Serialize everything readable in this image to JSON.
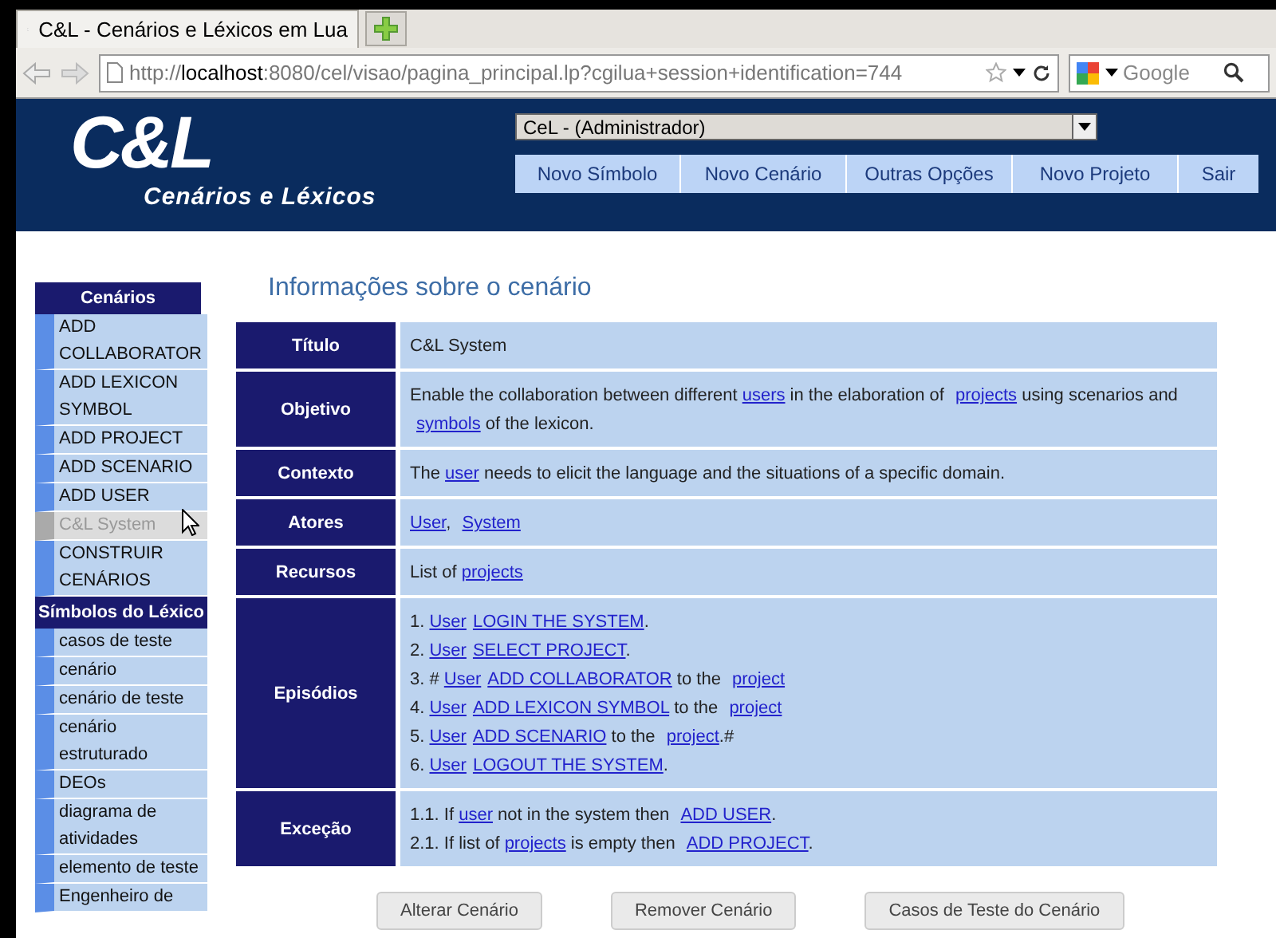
{
  "browser": {
    "tab_title": "C&L - Cenários e Léxicos em Lua",
    "url_prefix": "http://",
    "url_host": "localhost",
    "url_rest": ":8080/cel/visao/pagina_principal.lp?cgilua+session+identification=744",
    "search_placeholder": "Google"
  },
  "header": {
    "logo": "C&L",
    "subtitle": "Cenários e Léxicos",
    "project_select": "CeL - (Administrador)",
    "nav": [
      "Novo Símbolo",
      "Novo Cenário",
      "Outras Opções",
      "Novo Projeto",
      "Sair"
    ]
  },
  "sidebar": {
    "sections": [
      {
        "title": "Cenários",
        "items": [
          {
            "label": "ADD COLLABORATOR",
            "selected": false
          },
          {
            "label": "ADD LEXICON SYMBOL",
            "selected": false
          },
          {
            "label": "ADD PROJECT",
            "selected": false
          },
          {
            "label": "ADD SCENARIO",
            "selected": false
          },
          {
            "label": "ADD USER",
            "selected": false
          },
          {
            "label": "C&L System",
            "selected": true
          },
          {
            "label": "CONSTRUIR CENÁRIOS",
            "selected": false
          }
        ]
      },
      {
        "title": "Símbolos do Léxico",
        "items": [
          {
            "label": "casos de teste",
            "selected": false
          },
          {
            "label": "cenário",
            "selected": false
          },
          {
            "label": "cenário de teste",
            "selected": false
          },
          {
            "label": "cenário estruturado",
            "selected": false
          },
          {
            "label": "DEOs",
            "selected": false
          },
          {
            "label": "diagrama de atividades",
            "selected": false
          },
          {
            "label": "elemento de teste",
            "selected": false
          },
          {
            "label": "Engenheiro de",
            "selected": false
          }
        ]
      }
    ]
  },
  "main": {
    "title": "Informações sobre o cenário",
    "rows": [
      {
        "label": "Título",
        "lines": [
          [
            {
              "text": "C&L System"
            }
          ]
        ]
      },
      {
        "label": "Objetivo",
        "lines": [
          [
            {
              "text": "Enable the collaboration between different "
            },
            {
              "link": "users"
            },
            {
              "text": " in the elaboration of "
            },
            {
              "link": "projects"
            },
            {
              "text": " using scenarios and "
            },
            {
              "link": "symbols"
            },
            {
              "text": " of the lexicon."
            }
          ]
        ]
      },
      {
        "label": "Contexto",
        "lines": [
          [
            {
              "text": "The "
            },
            {
              "link": "user"
            },
            {
              "text": " needs to elicit the language and the situations of a specific domain."
            }
          ]
        ]
      },
      {
        "label": "Atores",
        "lines": [
          [
            {
              "link": "User"
            },
            {
              "text": ", "
            },
            {
              "link": "System"
            }
          ]
        ]
      },
      {
        "label": "Recursos",
        "lines": [
          [
            {
              "text": "List of "
            },
            {
              "link": "projects"
            }
          ]
        ]
      },
      {
        "label": "Episódios",
        "lines": [
          [
            {
              "text": "1. "
            },
            {
              "link": "User"
            },
            {
              "link": "LOGIN THE SYSTEM"
            },
            {
              "text": "."
            }
          ],
          [
            {
              "text": "2. "
            },
            {
              "link": "User"
            },
            {
              "link": "SELECT PROJECT"
            },
            {
              "text": "."
            }
          ],
          [
            {
              "text": "3. # "
            },
            {
              "link": "User"
            },
            {
              "link": "ADD COLLABORATOR"
            },
            {
              "text": " to the "
            },
            {
              "link": "project"
            }
          ],
          [
            {
              "text": "4. "
            },
            {
              "link": "User"
            },
            {
              "link": "ADD LEXICON SYMBOL"
            },
            {
              "text": " to the "
            },
            {
              "link": "project"
            }
          ],
          [
            {
              "text": "5. "
            },
            {
              "link": "User"
            },
            {
              "link": "ADD SCENARIO"
            },
            {
              "text": " to the "
            },
            {
              "link": "project"
            },
            {
              "text": ".#"
            }
          ],
          [
            {
              "text": "6. "
            },
            {
              "link": "User"
            },
            {
              "link": "LOGOUT THE SYSTEM"
            },
            {
              "text": "."
            }
          ]
        ]
      },
      {
        "label": "Exceção",
        "lines": [
          [
            {
              "text": "1.1. If "
            },
            {
              "link": "user"
            },
            {
              "text": " not in the system then "
            },
            {
              "link": "ADD USER"
            },
            {
              "text": "."
            }
          ],
          [
            {
              "text": "2.1. If list of "
            },
            {
              "link": "projects"
            },
            {
              "text": " is empty then "
            },
            {
              "link": "ADD PROJECT"
            },
            {
              "text": "."
            }
          ]
        ]
      }
    ],
    "buttons": [
      "Alterar Cenário",
      "Remover Cenário",
      "Casos de Teste do Cenário"
    ]
  }
}
